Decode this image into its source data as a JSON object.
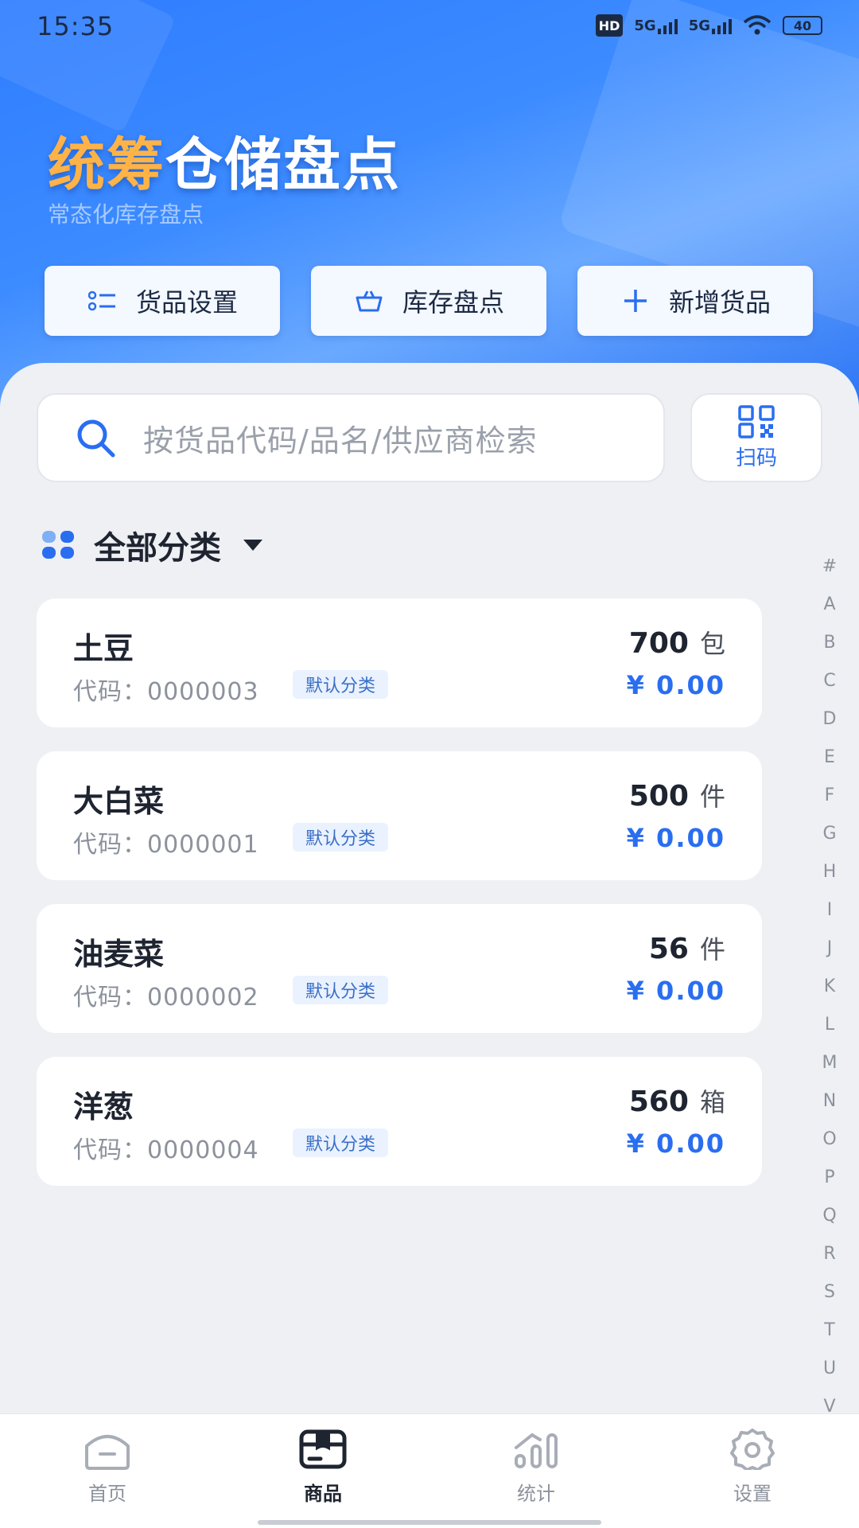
{
  "status_bar": {
    "time": "15:35",
    "hd": "HD",
    "net1": "5G",
    "net2": "5G",
    "battery": "40"
  },
  "header": {
    "title_highlight": "统筹",
    "title_rest": "仓储盘点",
    "subtitle": "常态化库存盘点"
  },
  "quick_actions": [
    {
      "label": "货品设置",
      "icon": "list-icon"
    },
    {
      "label": "库存盘点",
      "icon": "basket-icon"
    },
    {
      "label": "新增货品",
      "icon": "plus-icon"
    }
  ],
  "search": {
    "placeholder": "按货品代码/品名/供应商检索",
    "scan_label": "扫码"
  },
  "category": {
    "label": "全部分类"
  },
  "products": [
    {
      "name": "土豆",
      "code_label": "代码：",
      "code": "0000003",
      "tag": "默认分类",
      "qty": "700",
      "unit": "包",
      "price": "¥ 0.00"
    },
    {
      "name": "大白菜",
      "code_label": "代码：",
      "code": "0000001",
      "tag": "默认分类",
      "qty": "500",
      "unit": "件",
      "price": "¥ 0.00"
    },
    {
      "name": "油麦菜",
      "code_label": "代码：",
      "code": "0000002",
      "tag": "默认分类",
      "qty": "56",
      "unit": "件",
      "price": "¥ 0.00"
    },
    {
      "name": "洋葱",
      "code_label": "代码：",
      "code": "0000004",
      "tag": "默认分类",
      "qty": "560",
      "unit": "箱",
      "price": "¥ 0.00"
    }
  ],
  "alpha_index": [
    "#",
    "A",
    "B",
    "C",
    "D",
    "E",
    "F",
    "G",
    "H",
    "I",
    "J",
    "K",
    "L",
    "M",
    "N",
    "O",
    "P",
    "Q",
    "R",
    "S",
    "T",
    "U",
    "V"
  ],
  "tabs": [
    {
      "label": "首页",
      "icon": "home-icon",
      "active": false
    },
    {
      "label": "商品",
      "icon": "box-icon",
      "active": true
    },
    {
      "label": "统计",
      "icon": "chart-icon",
      "active": false
    },
    {
      "label": "设置",
      "icon": "gear-icon",
      "active": false
    }
  ],
  "colors": {
    "brand": "#2a6ef0",
    "highlight": "#ffb347",
    "background": "#eef0f4"
  }
}
